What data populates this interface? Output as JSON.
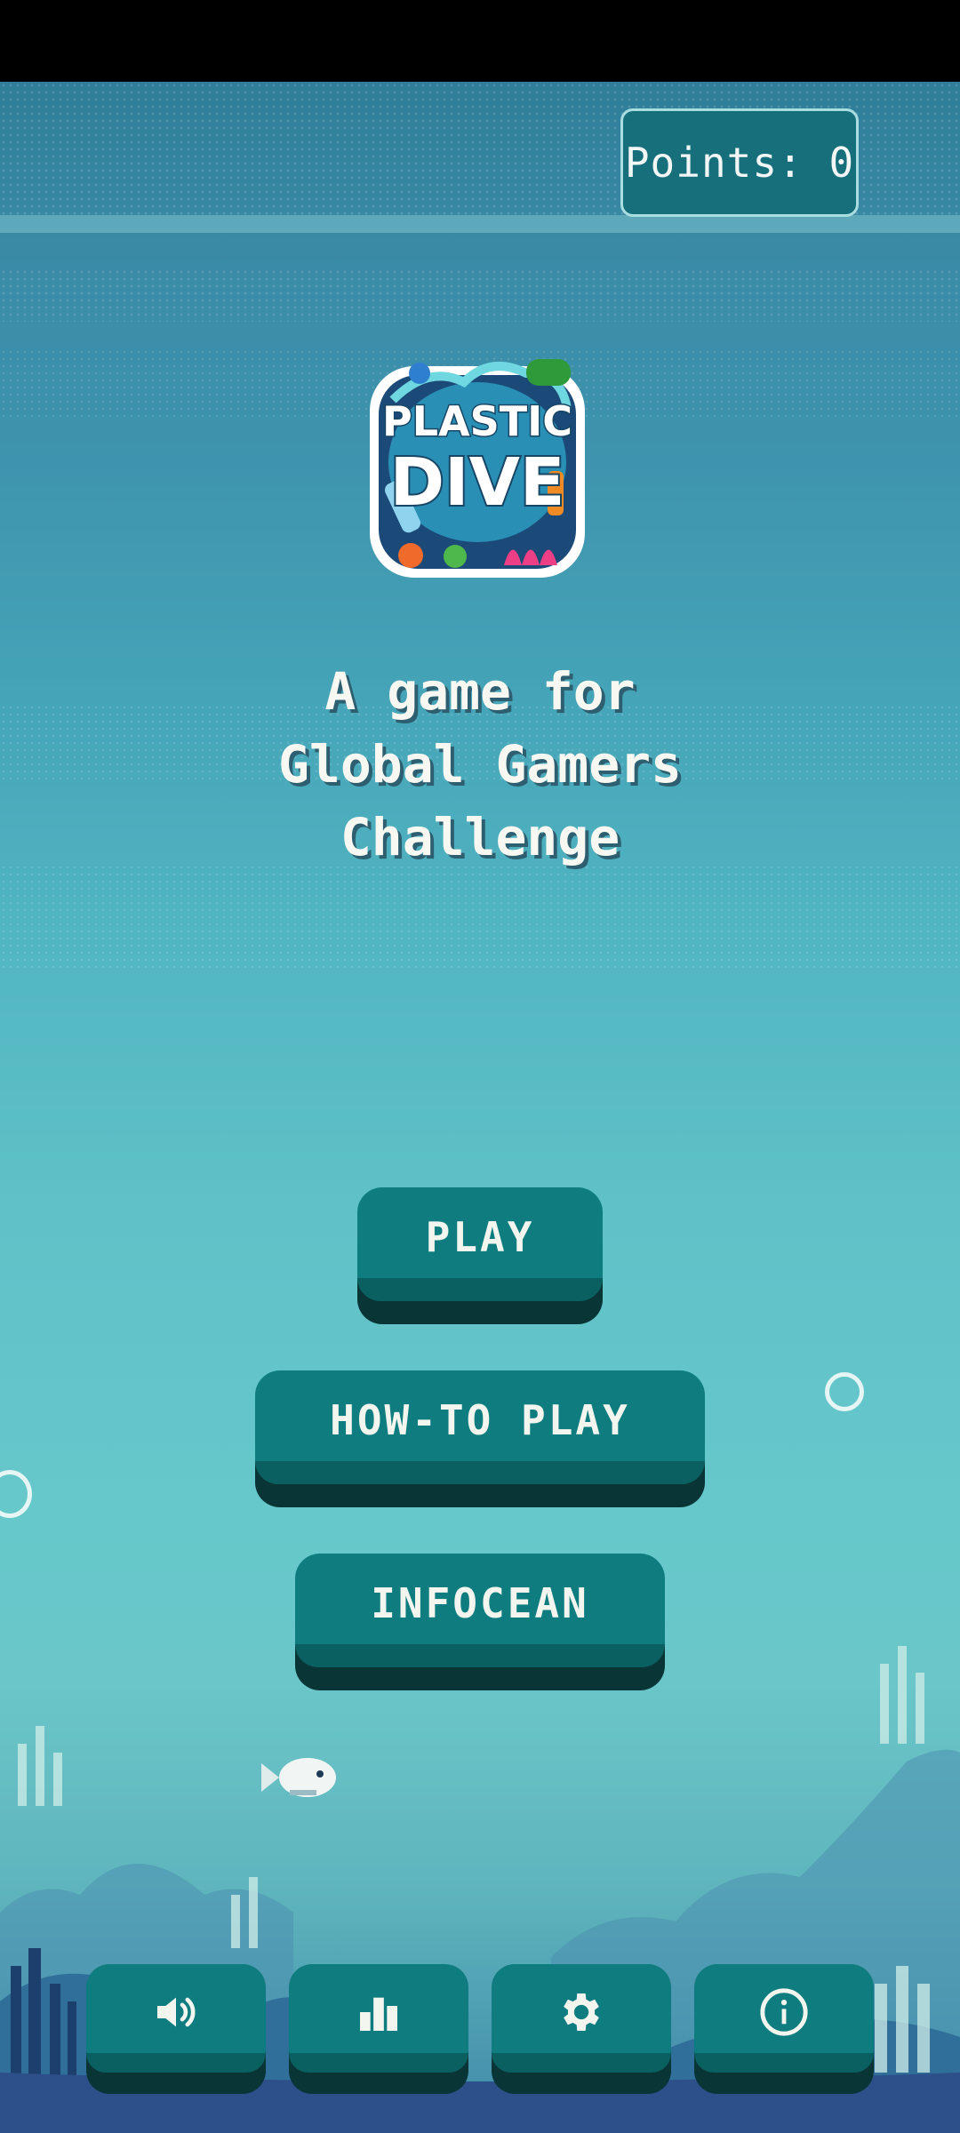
{
  "hud": {
    "points_label": "Points:",
    "points_value": "0"
  },
  "logo": {
    "line1": "PLASTIC",
    "line2": "DIVE"
  },
  "tagline": {
    "line1": "A game for",
    "line2": "Global Gamers",
    "line3": "Challenge"
  },
  "menu": {
    "play": "PLAY",
    "how_to_play": "HOW-TO PLAY",
    "infocean": "INFOCEAN"
  },
  "bottom_bar": [
    {
      "icon": "speaker-icon"
    },
    {
      "icon": "bar-chart-icon"
    },
    {
      "icon": "gear-icon"
    },
    {
      "icon": "info-icon"
    }
  ],
  "colors": {
    "button": "#0f7d80",
    "button_shadow": "#0a3536",
    "water_top": "#2f7d98",
    "water_mid": "#66c8cb",
    "text": "#f3f6ef"
  }
}
